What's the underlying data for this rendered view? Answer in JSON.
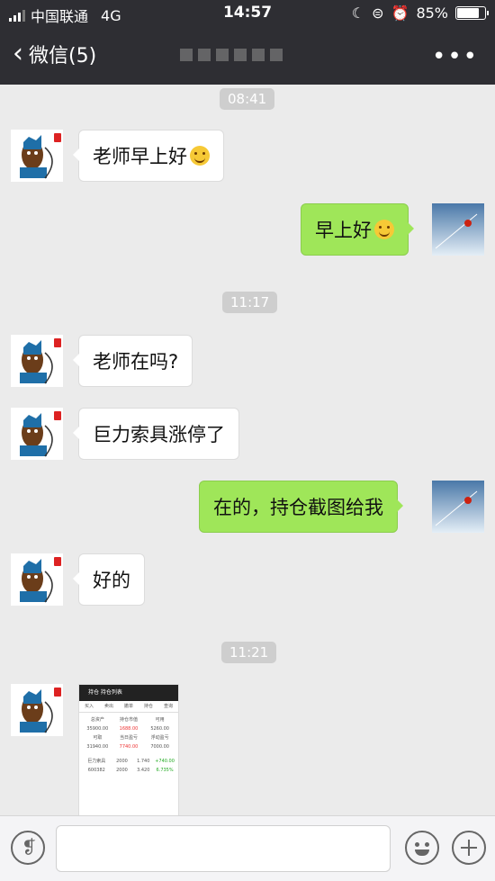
{
  "status_bar": {
    "carrier": "中国联通",
    "network": "4G",
    "time": "14:57",
    "battery_pct_text": "85%",
    "battery_level": 0.85
  },
  "nav": {
    "back_label": "微信(5)",
    "more_icon": "more-dots-icon"
  },
  "messages": [
    {
      "type": "time",
      "text": "08:41"
    },
    {
      "type": "left",
      "text": "老师早上好",
      "emoji": "grin-emoji"
    },
    {
      "type": "right",
      "text": "早上好",
      "emoji": "smile-emoji"
    },
    {
      "type": "time",
      "text": "11:17"
    },
    {
      "type": "left",
      "text": "老师在吗?"
    },
    {
      "type": "left",
      "text": "巨力索具涨停了"
    },
    {
      "type": "right",
      "text": "在的，持仓截图给我"
    },
    {
      "type": "left",
      "text": "好的"
    },
    {
      "type": "time",
      "text": "11:21"
    },
    {
      "type": "left-image",
      "image": "stock-position-screenshot"
    }
  ],
  "screenshot_thumb": {
    "header": "持仓 持仓列表",
    "tabs": [
      "买入",
      "卖出",
      "撤单",
      "持仓",
      "查询"
    ],
    "cells": [
      "总资产",
      "持仓市值",
      "可用",
      "35900.00",
      "1688.00",
      "5260.00",
      "可取",
      "当日盈亏",
      "浮动盈亏",
      "31940.00",
      "7740.00",
      "7000.00"
    ],
    "rows": [
      [
        "巨力索具",
        "2000",
        "1.740",
        "+740.00"
      ],
      [
        "600382",
        "2000",
        "3.420",
        "6.735%"
      ]
    ]
  },
  "colors": {
    "bar": "#2e2e33",
    "chat_bg": "#ebebeb",
    "bubble_mine": "#9fe659",
    "bubble_other": "#ffffff"
  },
  "input_bar": {
    "voice_icon": "voice-icon",
    "emoji_icon": "emoji-icon",
    "plus_icon": "plus-icon"
  }
}
